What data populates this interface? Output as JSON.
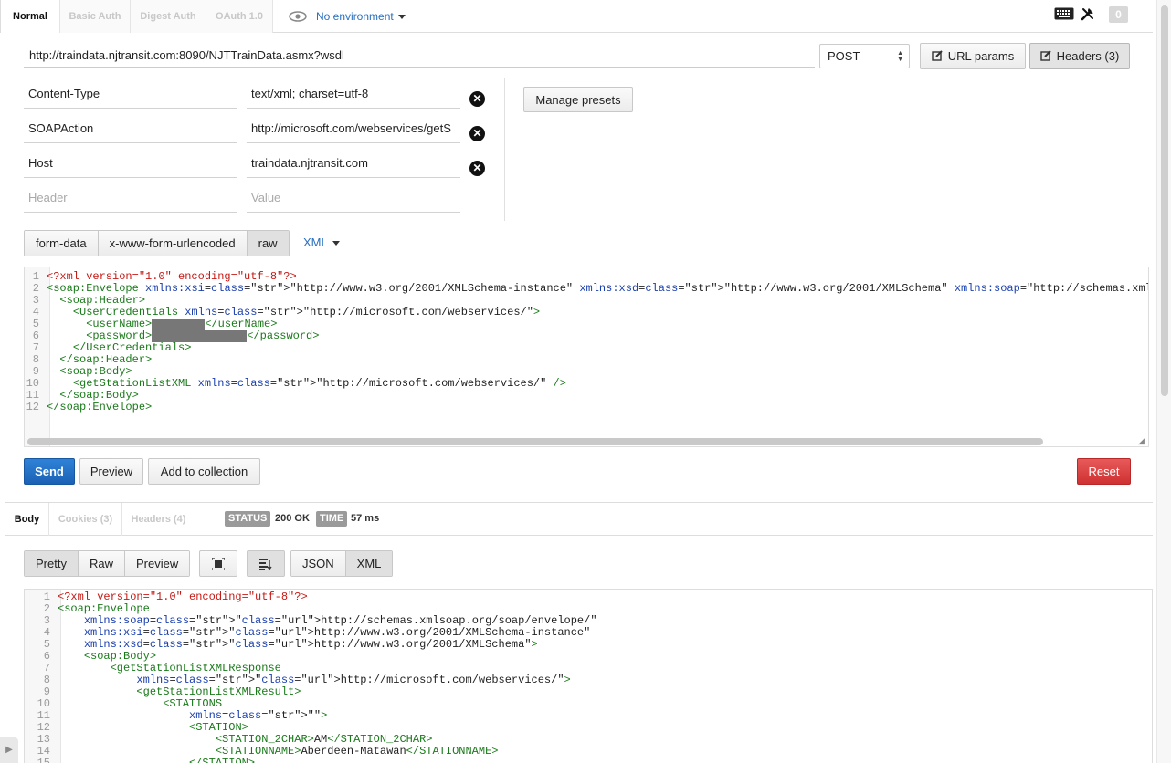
{
  "auth_tabs": [
    "Normal",
    "Basic Auth",
    "Digest Auth",
    "OAuth 1.0"
  ],
  "environment": {
    "label": "No environment"
  },
  "toolbar": {
    "counter": "0"
  },
  "request": {
    "url": "http://traindata.njtransit.com:8090/NJTTrainData.asmx?wsdl",
    "method": "POST",
    "url_params_label": "URL params",
    "headers_label": "Headers (3)",
    "manage_presets_label": "Manage presets"
  },
  "headers": [
    {
      "key": "Content-Type",
      "value": "text/xml; charset=utf-8"
    },
    {
      "key": "SOAPAction",
      "value": "http://microsoft.com/webservices/getS"
    },
    {
      "key": "Host",
      "value": "traindata.njtransit.com"
    }
  ],
  "header_placeholders": {
    "key": "Header",
    "value": "Value"
  },
  "body_modes": [
    "form-data",
    "x-www-form-urlencoded",
    "raw"
  ],
  "body_mode_selected": "raw",
  "body_language": "XML",
  "request_body_lines": [
    "<?xml version=\"1.0\" encoding=\"utf-8\"?>",
    "<soap:Envelope xmlns:xsi=\"http://www.w3.org/2001/XMLSchema-instance\" xmlns:xsd=\"http://www.w3.org/2001/XMLSchema\" xmlns:soap=\"http://schemas.xmlsoap.org/s",
    "  <soap:Header>",
    "    <UserCredentials xmlns=\"http://microsoft.com/webservices/\">",
    "      <userName>",
    "      <password>",
    "    </UserCredentials>",
    "  </soap:Header>",
    "  <soap:Body>",
    "    <getStationListXML xmlns=\"http://microsoft.com/webservices/\" />",
    "  </soap:Body>",
    "</soap:Envelope>"
  ],
  "actions": {
    "send": "Send",
    "preview": "Preview",
    "add_to_collection": "Add to collection",
    "reset": "Reset"
  },
  "response": {
    "tabs": [
      "Body",
      "Cookies (3)",
      "Headers (4)"
    ],
    "status_label": "STATUS",
    "status_value": "200 OK",
    "time_label": "TIME",
    "time_value": "57 ms",
    "view_modes": [
      "Pretty",
      "Raw",
      "Preview"
    ],
    "formats": [
      "JSON",
      "XML"
    ],
    "body_lines": [
      "<?xml version=\"1.0\" encoding=\"utf-8\"?>",
      "<soap:Envelope",
      "    xmlns:soap=\"http://schemas.xmlsoap.org/soap/envelope/\"",
      "    xmlns:xsi=\"http://www.w3.org/2001/XMLSchema-instance\"",
      "    xmlns:xsd=\"http://www.w3.org/2001/XMLSchema\">",
      "    <soap:Body>",
      "        <getStationListXMLResponse",
      "            xmlns=\"http://microsoft.com/webservices/\">",
      "            <getStationListXMLResult>",
      "                <STATIONS",
      "                    xmlns=\"\">",
      "                    <STATION>",
      "                        <STATION_2CHAR>AM</STATION_2CHAR>",
      "                        <STATIONNAME>Aberdeen-Matawan</STATIONNAME>",
      "                    </STATION>"
    ]
  },
  "colors": {
    "send": "#1b62b5",
    "reset": "#cf3131",
    "link": "#2a6fbe"
  }
}
